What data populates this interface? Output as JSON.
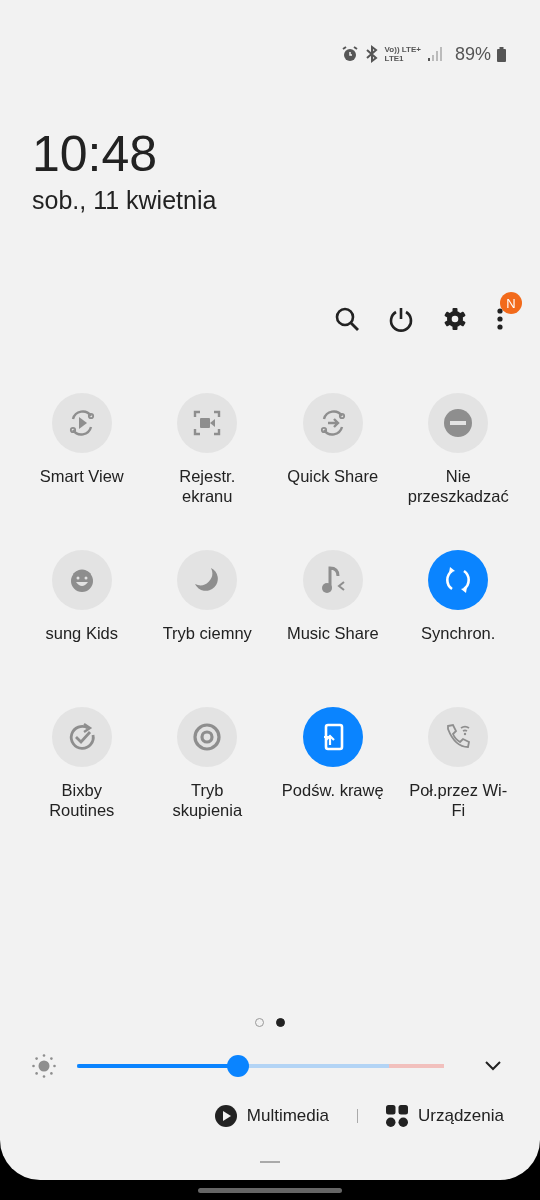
{
  "status_bar": {
    "network_top": "Vo)) LTE+",
    "network_bottom": "LTE1",
    "battery": "89%"
  },
  "clock": {
    "time": "10:48",
    "date": "sob., 11 kwietnia"
  },
  "actions": {
    "badge": "N"
  },
  "tiles": [
    {
      "label": "Smart View",
      "on": false
    },
    {
      "label": "Rejestr. ekranu",
      "on": false
    },
    {
      "label": "Quick Share",
      "on": false
    },
    {
      "label": "Nie przeszkadzać",
      "on": false
    },
    {
      "label": "sung Kids",
      "on": false
    },
    {
      "label": "Tryb ciemny",
      "on": false
    },
    {
      "label": "Music Share",
      "on": false
    },
    {
      "label": "Synchron.",
      "on": true
    },
    {
      "label": "Bixby Routines",
      "on": false
    },
    {
      "label": "Tryb skupienia",
      "on": false
    },
    {
      "label": "Podśw. krawę",
      "on": true
    },
    {
      "label": "Poł.przez Wi-Fi",
      "on": false
    }
  ],
  "pages": [
    {
      "selected": false
    },
    {
      "selected": true
    }
  ],
  "brightness": {
    "level": 0.44
  },
  "bottom_buttons": [
    {
      "label": "Multimedia"
    },
    {
      "label": "Urządzenia"
    }
  ]
}
